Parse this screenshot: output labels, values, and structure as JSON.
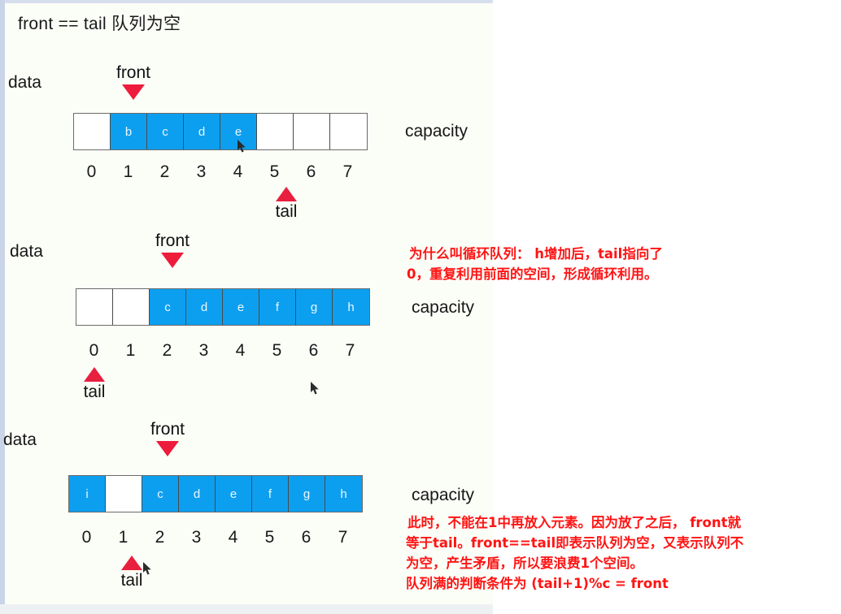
{
  "header": {
    "text": "front == tail 队列为空"
  },
  "labels": {
    "data": "data",
    "capacity": "capacity",
    "front": "front",
    "tail": "tail"
  },
  "diagrams": [
    {
      "name": "queue-state-1",
      "data_label": "data",
      "capacity_label": "capacity",
      "indexes": [
        "0",
        "1",
        "2",
        "3",
        "4",
        "5",
        "6",
        "7"
      ],
      "cells": [
        {
          "value": "",
          "filled": false
        },
        {
          "value": "b",
          "filled": true
        },
        {
          "value": "c",
          "filled": true
        },
        {
          "value": "d",
          "filled": true
        },
        {
          "value": "e",
          "filled": true
        },
        {
          "value": "",
          "filled": false
        },
        {
          "value": "",
          "filled": false
        },
        {
          "value": "",
          "filled": false
        }
      ],
      "front_label": "front",
      "front_index": 1,
      "tail_label": "tail",
      "tail_index": 5
    },
    {
      "name": "queue-state-2",
      "data_label": "data",
      "capacity_label": "capacity",
      "indexes": [
        "0",
        "1",
        "2",
        "3",
        "4",
        "5",
        "6",
        "7"
      ],
      "cells": [
        {
          "value": "",
          "filled": false
        },
        {
          "value": "",
          "filled": false
        },
        {
          "value": "c",
          "filled": true
        },
        {
          "value": "d",
          "filled": true
        },
        {
          "value": "e",
          "filled": true
        },
        {
          "value": "f",
          "filled": true
        },
        {
          "value": "g",
          "filled": true
        },
        {
          "value": "h",
          "filled": true
        }
      ],
      "front_label": "front",
      "front_index": 2,
      "tail_label": "tail",
      "tail_index": 0
    },
    {
      "name": "queue-state-3",
      "data_label": "data",
      "capacity_label": "capacity",
      "indexes": [
        "0",
        "1",
        "2",
        "3",
        "4",
        "5",
        "6",
        "7"
      ],
      "cells": [
        {
          "value": "i",
          "filled": true
        },
        {
          "value": "",
          "filled": false
        },
        {
          "value": "c",
          "filled": true
        },
        {
          "value": "d",
          "filled": true
        },
        {
          "value": "e",
          "filled": true
        },
        {
          "value": "f",
          "filled": true
        },
        {
          "value": "g",
          "filled": true
        },
        {
          "value": "h",
          "filled": true
        }
      ],
      "front_label": "front",
      "front_index": 2,
      "tail_label": "tail",
      "tail_index": 1
    }
  ],
  "annotations": {
    "top": [
      "为什么叫循环队列： h增加后，tail指向了",
      "0，重复利用前面的空间，形成循环利用。"
    ],
    "bottom": [
      "此时，不能在1中再放入元素。因为放了之后， front就",
      "等于tail。front==tail即表示队列为空，又表示队列不",
      "为空，产生矛盾，所以要浪费1个空间。",
      "队列满的判断条件为 (tail+1)%c = front"
    ]
  },
  "colors": {
    "cell_filled": "#0c9ff0",
    "pointer_red": "#ee1c3c",
    "annotation_red": "#ff1414",
    "slide_background": "#fbfdf7"
  }
}
